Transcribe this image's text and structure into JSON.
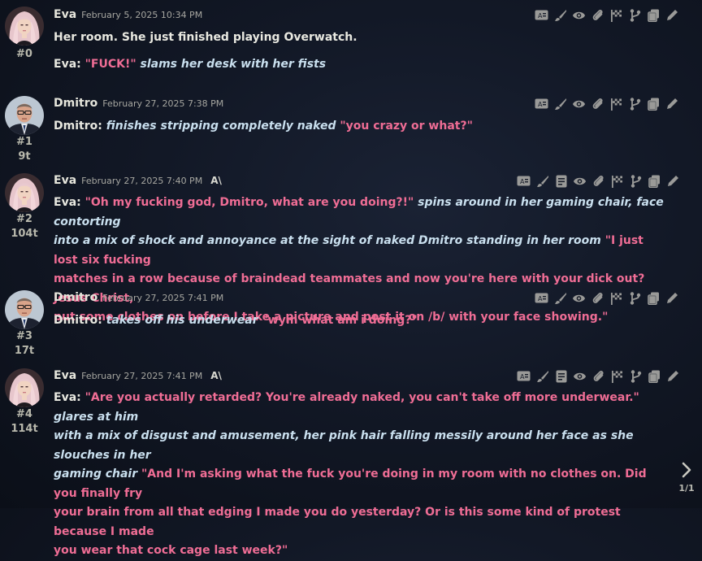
{
  "messages": [
    {
      "name": "Eva",
      "date": "February 5, 2025 10:34 PM",
      "index": "#0",
      "tokens": "",
      "ai_badge": "",
      "lines": [
        [
          {
            "t": "plain",
            "v": "Her room. She just finished playing Overwatch."
          }
        ],
        [
          {
            "t": "speaker",
            "v": "Eva: "
          },
          {
            "t": "q",
            "v": "\"FUCK!\" "
          },
          {
            "t": "act",
            "v": "slams her desk with her fists"
          }
        ]
      ]
    },
    {
      "name": "Dmitro",
      "date": "February 27, 2025 7:38 PM",
      "index": "#1",
      "tokens": "9t",
      "ai_badge": "",
      "lines": [
        [
          {
            "t": "speaker",
            "v": "Dmitro: "
          },
          {
            "t": "act",
            "v": "finishes stripping completely naked "
          },
          {
            "t": "q",
            "v": "\"you crazy or what?\""
          }
        ]
      ]
    },
    {
      "name": "Eva",
      "date": "February 27, 2025 7:40 PM",
      "index": "#2",
      "tokens": "104t",
      "ai_badge": "A\\",
      "lines": [
        [
          {
            "t": "speaker",
            "v": "Eva: "
          },
          {
            "t": "q",
            "v": "\"Oh my fucking god, Dmitro, what are you doing?!\" "
          },
          {
            "t": "act",
            "v": "spins around in her gaming chair, face contorting"
          }
        ],
        [
          {
            "t": "act",
            "v": "into a mix of shock and annoyance at the sight of naked Dmitro standing in her room "
          },
          {
            "t": "q",
            "v": "\"I just lost six fucking"
          }
        ],
        [
          {
            "t": "q",
            "v": "matches in a row because of braindead teammates and now you're here with your dick out? Jesus Christ,"
          }
        ],
        [
          {
            "t": "q",
            "v": "put some clothes on before I take a picture and post it on /b/ with your face showing.\""
          }
        ]
      ]
    },
    {
      "name": "Dmitro",
      "date": "February 27, 2025 7:41 PM",
      "index": "#3",
      "tokens": "17t",
      "ai_badge": "",
      "lines": [
        [
          {
            "t": "speaker",
            "v": "Dmitro: "
          },
          {
            "t": "act",
            "v": "takes off his underwear "
          },
          {
            "t": "q",
            "v": "\"wym what am i doing?\""
          }
        ]
      ]
    },
    {
      "name": "Eva",
      "date": "February 27, 2025 7:41 PM",
      "index": "#4",
      "tokens": "114t",
      "ai_badge": "A\\",
      "lines": [
        [
          {
            "t": "speaker",
            "v": "Eva: "
          },
          {
            "t": "q",
            "v": "\"Are you actually retarded? You're already naked, you can't take off more underwear.\" "
          },
          {
            "t": "act",
            "v": "glares at him"
          }
        ],
        [
          {
            "t": "act",
            "v": "with a mix of disgust and amusement, her pink hair falling messily around her face as she slouches in her"
          }
        ],
        [
          {
            "t": "act",
            "v": "gaming chair "
          },
          {
            "t": "q",
            "v": "\"And I'm asking what the fuck you're doing in my room with no clothes on. Did you finally fry"
          }
        ],
        [
          {
            "t": "q",
            "v": "your brain from all that edging I made you do yesterday? Or is this some kind of protest because I made"
          }
        ],
        [
          {
            "t": "q",
            "v": "you wear that cock cage last week?\""
          }
        ]
      ]
    }
  ],
  "pager": {
    "label": "1/1",
    "icon": "chevron-right-icon"
  },
  "colors": {
    "quote": "#ef6d95",
    "action": "#c9dfee",
    "text": "#e8e8e0",
    "background": "#121826"
  }
}
